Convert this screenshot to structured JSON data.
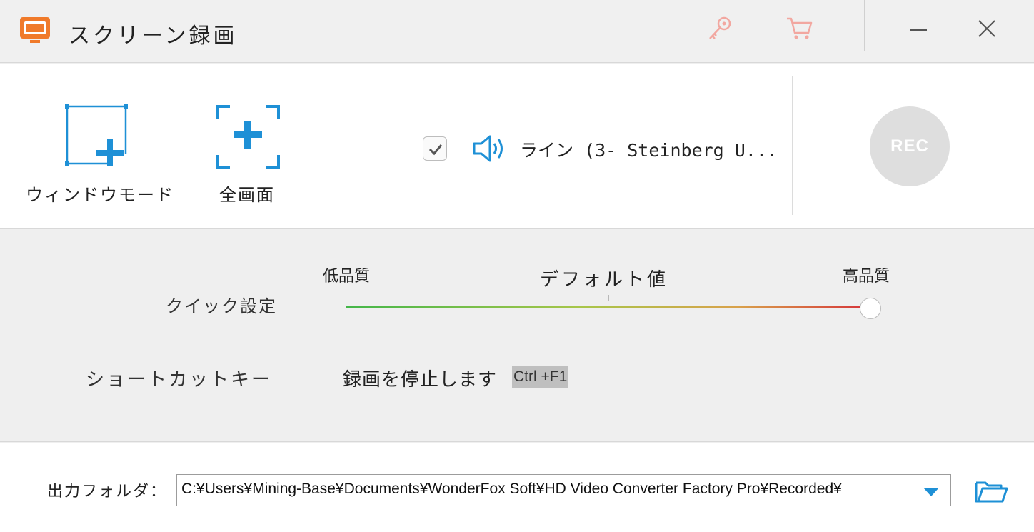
{
  "window": {
    "title": "スクリーン録画",
    "icons": [
      "screen-record-app-icon",
      "key-icon",
      "cart-icon",
      "minimize-icon",
      "close-icon"
    ]
  },
  "modes": {
    "window_mode_label": "ウィンドウモード",
    "full_screen_label": "全画面"
  },
  "audio": {
    "enabled": true,
    "device_label": "ライン (3- Steinberg U..."
  },
  "rec_button": {
    "label": "REC"
  },
  "quick_settings": {
    "label": "クイック設定",
    "low_label": "低品質",
    "default_label": "デフォルト値",
    "high_label": "高品質",
    "level": 1.0
  },
  "shortcut": {
    "label": "ショートカットキー",
    "description": "録画を停止します",
    "key": "Ctrl +F1"
  },
  "output": {
    "label": "出力フォルダ：",
    "path": "C:¥Users¥Mining-Base¥Documents¥WonderFox Soft¥HD Video Converter Factory Pro¥Recorded¥"
  },
  "colors": {
    "accent_blue": "#1e90d6",
    "app_orange": "#f07a2a",
    "titlebar_icon_pink": "#f2a7a0",
    "rec_gray": "#dedede"
  }
}
